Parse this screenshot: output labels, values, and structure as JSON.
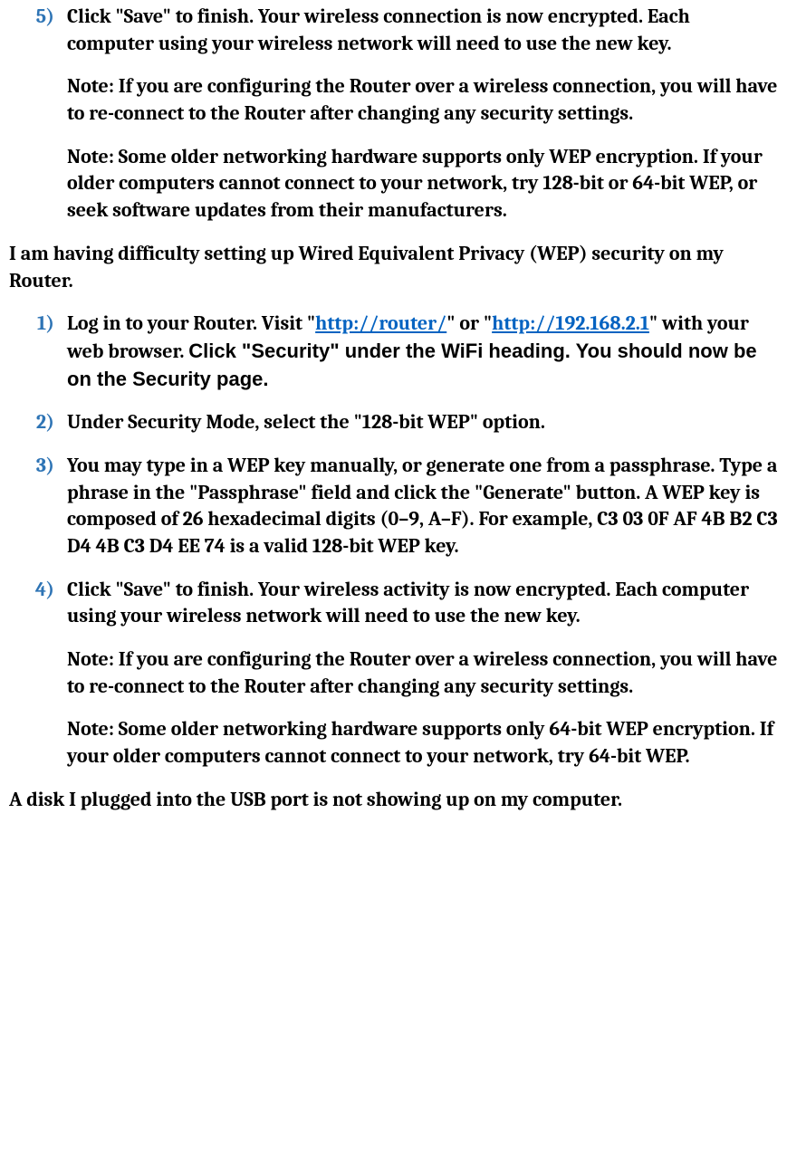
{
  "topList": {
    "item5": {
      "marker": "5)",
      "p1": "Click \"Save\" to finish. Your wireless connection is now encrypted. Each computer using your wireless network will need to use the new key.",
      "p2": "Note: If you are configuring the Router over a wireless connection, you will have to re-connect to the Router after changing any security settings.",
      "p3": "Note: Some older networking hardware supports only WEP encryption. If your older computers cannot connect to your network, try 128-bit or 64-bit WEP, or seek software updates from their manufacturers."
    }
  },
  "heading_wep": "I am having difficulty setting up Wired Equivalent Privacy (WEP) security on my Router.",
  "wepList": {
    "item1": {
      "marker": "1)",
      "pre": "Log in to your Router. Visit \"",
      "link1_text": "http://router/",
      "mid1": "\" or \"",
      "link2_text": "http://192.168.2.1",
      "mid2": "\" with your web browser. ",
      "arial_lead": "Click \"",
      "arial_bold_first": "Security",
      "arial_rest": "\" under the WiFi heading. You should now be on the Security page."
    },
    "item2": {
      "marker": "2)",
      "p1": "Under Security Mode, select the \"128-bit WEP\" option."
    },
    "item3": {
      "marker": "3)",
      "p1": "You may type in a WEP key manually, or generate one from a passphrase. Type a phrase in the \"Passphrase\" field and click the \"Generate\" button. A WEP key is composed of 26 hexadecimal digits (0–9, A–F). For example, C3 03 0F AF 4B B2 C3 D4 4B C3 D4 EE 74 is a valid 128-bit WEP key."
    },
    "item4": {
      "marker": "4)",
      "p1": "Click \"Save\" to finish. Your wireless activity is now encrypted. Each computer using your wireless network will need to use the new key.",
      "p2": "Note: If you are configuring the Router over a wireless connection, you will have to re-connect to the Router after changing any security settings.",
      "p3": "Note: Some older networking hardware supports only 64-bit WEP encryption. If your older computers cannot connect to your network, try 64-bit WEP."
    }
  },
  "heading_usb": "A disk I plugged into the USB port is not showing up on my computer."
}
